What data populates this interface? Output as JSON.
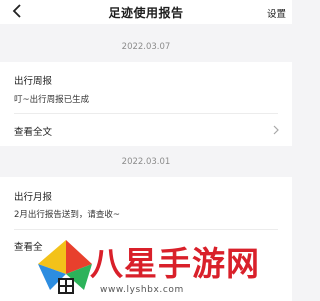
{
  "nav": {
    "title": "足迹使用报告",
    "settings_label": "设置"
  },
  "reports": [
    {
      "date": "2022.03.07",
      "title": "出行周报",
      "message": "叮~出行周报已生成",
      "link": "查看全文"
    },
    {
      "date": "2022.03.01",
      "title": "出行月报",
      "message": "2月出行报告送到，请查收~",
      "link": "查看全"
    }
  ],
  "watermark": {
    "brand": "八星手游网",
    "url": "www.lyshbx.com"
  },
  "colors": {
    "background": "#f4f4f6",
    "card": "#ffffff",
    "brand_red": "#d9202a"
  }
}
